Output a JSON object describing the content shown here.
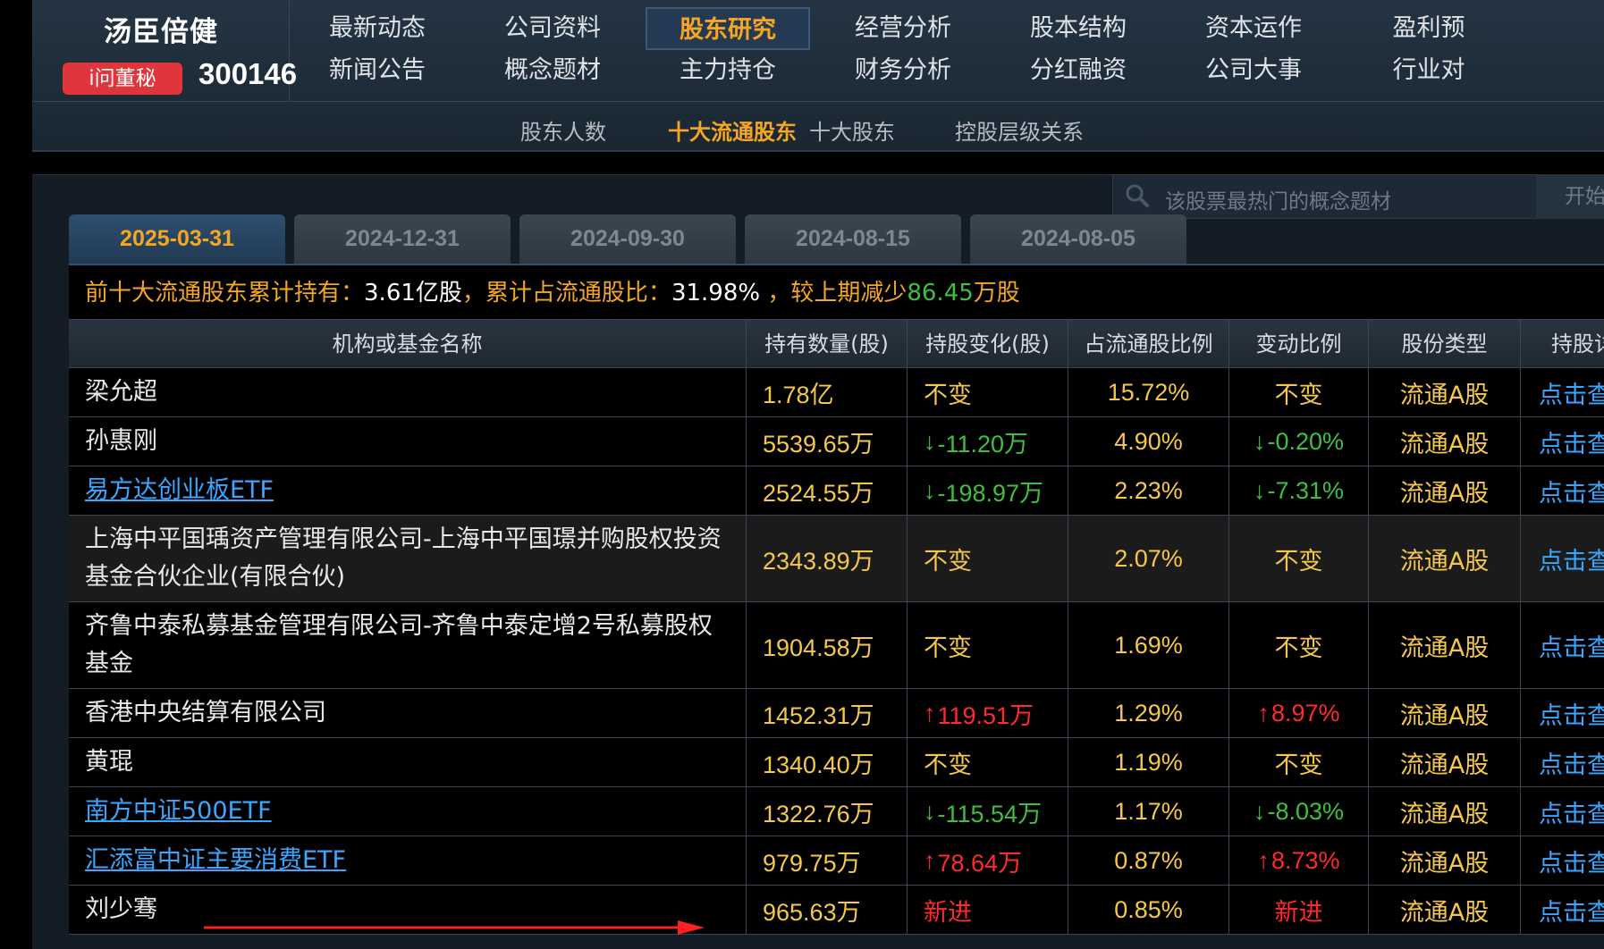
{
  "brand": {
    "name": "汤臣倍健",
    "badge": "i问董秘",
    "code": "300146"
  },
  "nav_main": [
    {
      "label": "最新动态",
      "row": 0,
      "col": 0
    },
    {
      "label": "公司资料",
      "row": 0,
      "col": 1
    },
    {
      "label": "股东研究",
      "row": 0,
      "col": 2,
      "active": true
    },
    {
      "label": "经营分析",
      "row": 0,
      "col": 3
    },
    {
      "label": "股本结构",
      "row": 0,
      "col": 4
    },
    {
      "label": "资本运作",
      "row": 0,
      "col": 5
    },
    {
      "label": "盈利预",
      "row": 0,
      "col": 6
    },
    {
      "label": "新闻公告",
      "row": 1,
      "col": 0
    },
    {
      "label": "概念题材",
      "row": 1,
      "col": 1
    },
    {
      "label": "主力持仓",
      "row": 1,
      "col": 2
    },
    {
      "label": "财务分析",
      "row": 1,
      "col": 3
    },
    {
      "label": "分红融资",
      "row": 1,
      "col": 4
    },
    {
      "label": "公司大事",
      "row": 1,
      "col": 5
    },
    {
      "label": "行业对",
      "row": 1,
      "col": 6
    }
  ],
  "nav_sub": [
    {
      "label": "股东人数"
    },
    {
      "label": "十大流通股东",
      "active": true
    },
    {
      "label": "十大股东"
    },
    {
      "label": "控股层级关系"
    }
  ],
  "search": {
    "placeholder": "该股票最热门的概念题材",
    "button": "开始"
  },
  "date_tabs": [
    {
      "label": "2025-03-31",
      "active": true
    },
    {
      "label": "2024-12-31"
    },
    {
      "label": "2024-09-30"
    },
    {
      "label": "2024-08-15"
    },
    {
      "label": "2024-08-05"
    }
  ],
  "summary": {
    "label1": "前十大流通股东累计持有：",
    "value1": "3.61亿股",
    "label2": "，累计占流通股比：",
    "value2": "31.98%",
    "label3": " ，较上期减少",
    "value3": "86.45",
    "unit3": "万股"
  },
  "table": {
    "headers": [
      "机构或基金名称",
      "持有数量(股)",
      "持股变化(股)",
      "占流通股比例",
      "变动比例",
      "股份类型",
      "持股详情"
    ],
    "rows": [
      {
        "name": "梁允超",
        "link": false,
        "holding": "1.78亿",
        "change": "不变",
        "change_dir": "flat",
        "pct": "15.72%",
        "rate": "不变",
        "rate_dir": "flat",
        "type": "流通A股",
        "more": "点击查看"
      },
      {
        "name": "孙惠刚",
        "link": false,
        "holding": "5539.65万",
        "change": "-11.20万",
        "change_dir": "down",
        "pct": "4.90%",
        "rate": "-0.20%",
        "rate_dir": "down",
        "type": "流通A股",
        "more": "点击查看"
      },
      {
        "name": "易方达创业板ETF",
        "link": true,
        "holding": "2524.55万",
        "change": "-198.97万",
        "change_dir": "down",
        "pct": "2.23%",
        "rate": "-7.31%",
        "rate_dir": "down",
        "type": "流通A股",
        "more": "点击查看"
      },
      {
        "name": "上海中平国瑀资产管理有限公司-上海中平国璟并购股权投资基金合伙企业(有限合伙)",
        "link": false,
        "holding": "2343.89万",
        "change": "不变",
        "change_dir": "flat",
        "pct": "2.07%",
        "rate": "不变",
        "rate_dir": "flat",
        "type": "流通A股",
        "more": "点击查看",
        "tall": true
      },
      {
        "name": "齐鲁中泰私募基金管理有限公司-齐鲁中泰定增2号私募股权基金",
        "link": false,
        "holding": "1904.58万",
        "change": "不变",
        "change_dir": "flat",
        "pct": "1.69%",
        "rate": "不变",
        "rate_dir": "flat",
        "type": "流通A股",
        "more": "点击查看",
        "tall": true
      },
      {
        "name": "香港中央结算有限公司",
        "link": false,
        "holding": "1452.31万",
        "change": "119.51万",
        "change_dir": "up",
        "pct": "1.29%",
        "rate": "8.97%",
        "rate_dir": "up",
        "type": "流通A股",
        "more": "点击查看"
      },
      {
        "name": "黄琨",
        "link": false,
        "holding": "1340.40万",
        "change": "不变",
        "change_dir": "flat",
        "pct": "1.19%",
        "rate": "不变",
        "rate_dir": "flat",
        "type": "流通A股",
        "more": "点击查看"
      },
      {
        "name": "南方中证500ETF",
        "link": true,
        "holding": "1322.76万",
        "change": "-115.54万",
        "change_dir": "down",
        "pct": "1.17%",
        "rate": "-8.03%",
        "rate_dir": "down",
        "type": "流通A股",
        "more": "点击查看"
      },
      {
        "name": "汇添富中证主要消费ETF",
        "link": true,
        "holding": "979.75万",
        "change": "78.64万",
        "change_dir": "up",
        "pct": "0.87%",
        "rate": "8.73%",
        "rate_dir": "up",
        "type": "流通A股",
        "more": "点击查看"
      },
      {
        "name": "刘少骞",
        "link": false,
        "holding": "965.63万",
        "change": "新进",
        "change_dir": "new",
        "pct": "0.85%",
        "rate": "新进",
        "rate_dir": "new",
        "type": "流通A股",
        "more": "点击查看"
      }
    ]
  },
  "colors": {
    "accent": "#f5a623",
    "value": "#f5c84a",
    "down": "#3fbf3f",
    "up": "#ff2b2b",
    "link": "#3aa6ff",
    "annotation": "#ff2020"
  }
}
